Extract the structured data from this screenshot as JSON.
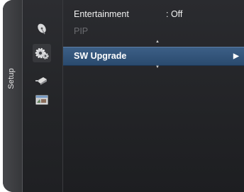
{
  "sidebar": {
    "label": "Setup"
  },
  "icons": [
    "satellite-dish-icon",
    "gear-icon",
    "input-plug-icon",
    "application-window-icon"
  ],
  "menu": {
    "items": [
      {
        "label": "Entertainment",
        "value": ": Off",
        "state": "normal"
      },
      {
        "label": "PIP",
        "value": "",
        "state": "disabled"
      },
      {
        "label": "SW Upgrade",
        "value": "",
        "state": "selected",
        "arrow": "▶"
      }
    ],
    "scroll_up": "▲",
    "scroll_down": "▼"
  },
  "colors": {
    "background": "#1e1f22",
    "highlight": "#2f5077",
    "text": "#ffffff",
    "disabled_text": "#6b6c70"
  }
}
